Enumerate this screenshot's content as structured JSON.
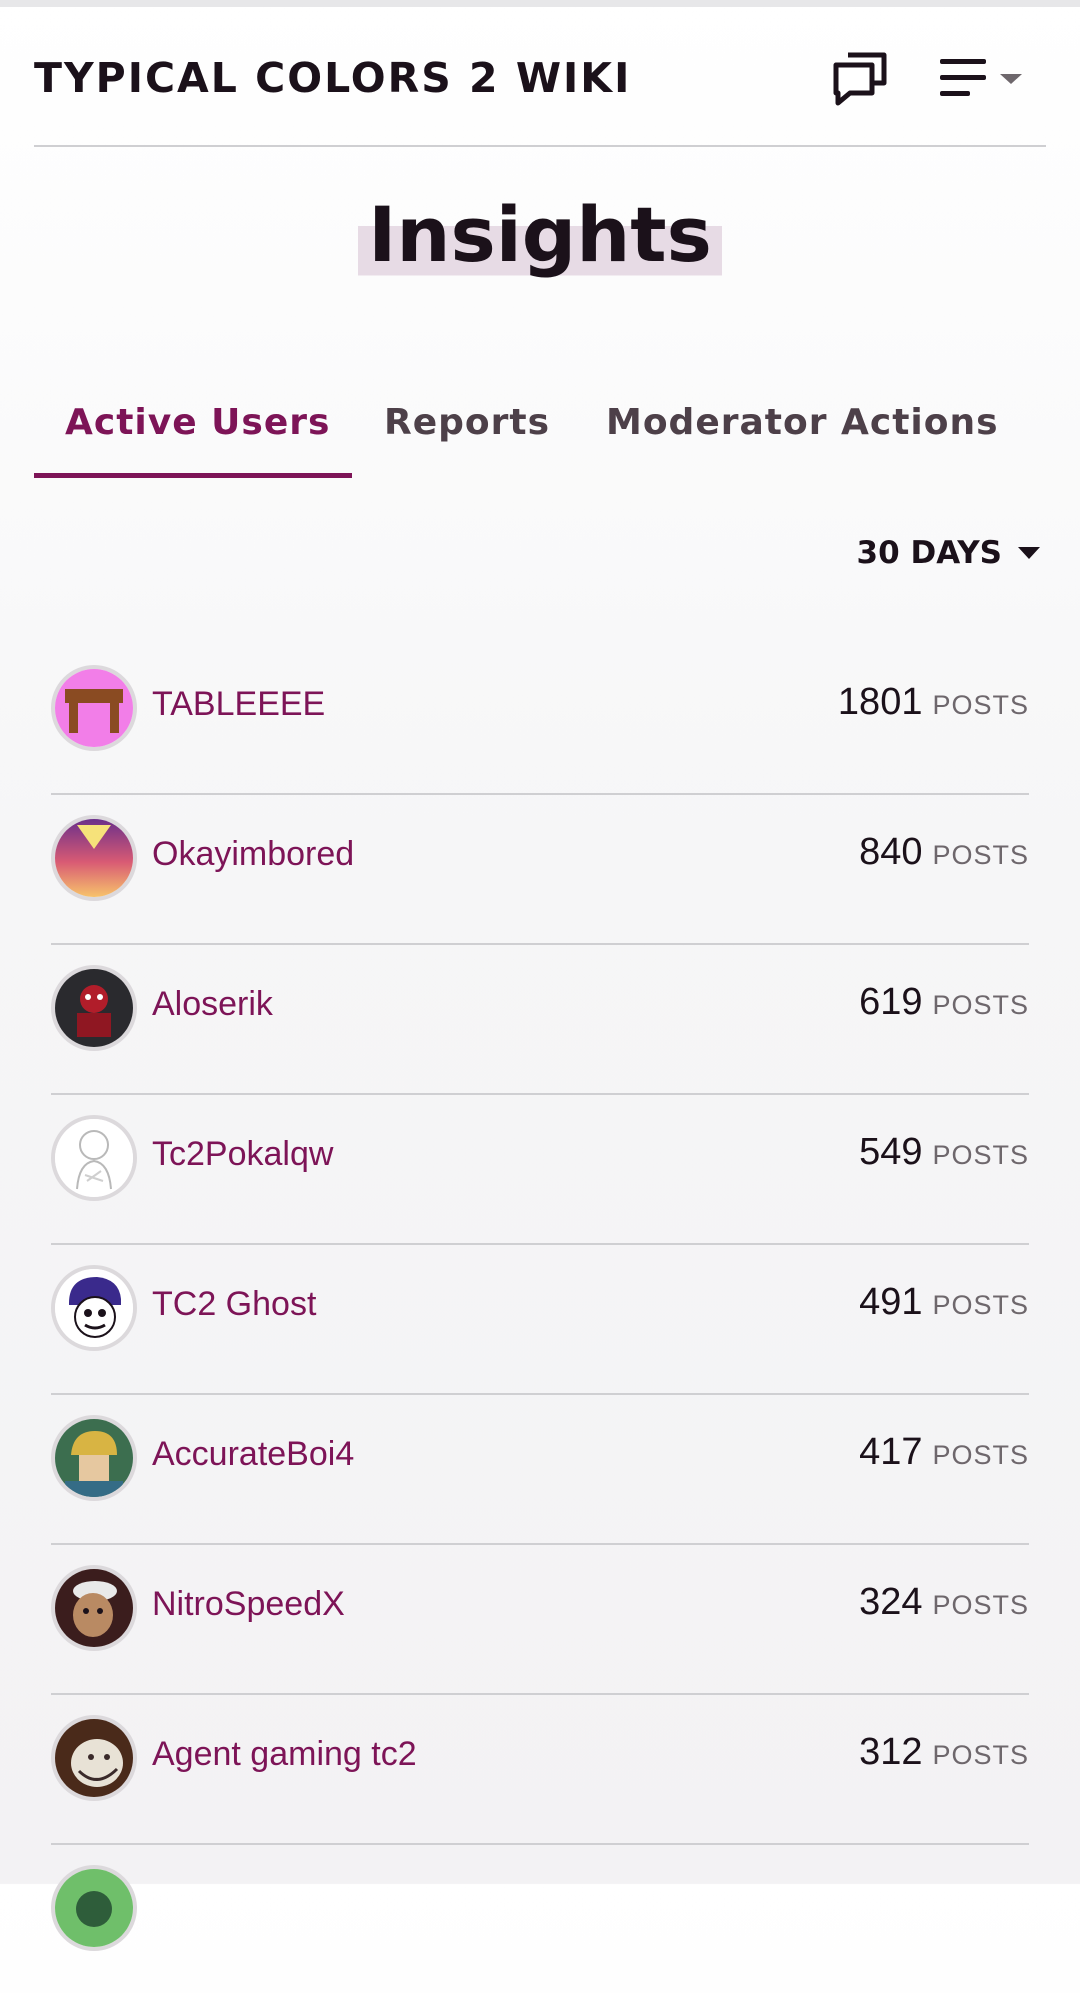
{
  "header": {
    "wiki_title": "TYPICAL COLORS 2 WIKI",
    "discussions_icon": "speech-bubbles-icon",
    "menu_icon": "hamburger-menu-icon"
  },
  "page": {
    "title": "Insights"
  },
  "tabs": [
    {
      "label": "Active Users",
      "active": true
    },
    {
      "label": "Reports",
      "active": false
    },
    {
      "label": "Moderator Actions",
      "active": false
    }
  ],
  "range": {
    "label": "30 DAYS"
  },
  "users": [
    {
      "name": "TABLEEEE",
      "count": "1801",
      "unit": "POSTS",
      "avatar": "table-avatar"
    },
    {
      "name": "Okayimbored",
      "count": "840",
      "unit": "POSTS",
      "avatar": "sunset-avatar"
    },
    {
      "name": "Aloserik",
      "count": "619",
      "unit": "POSTS",
      "avatar": "dark-figure-avatar"
    },
    {
      "name": "Tc2Pokalqw",
      "count": "549",
      "unit": "POSTS",
      "avatar": "sketch-avatar"
    },
    {
      "name": "TC2 Ghost",
      "count": "491",
      "unit": "POSTS",
      "avatar": "ghost-avatar"
    },
    {
      "name": "AccurateBoi4",
      "count": "417",
      "unit": "POSTS",
      "avatar": "helmet-avatar"
    },
    {
      "name": "NitroSpeedX",
      "count": "324",
      "unit": "POSTS",
      "avatar": "face-avatar"
    },
    {
      "name": "Agent gaming tc2",
      "count": "312",
      "unit": "POSTS",
      "avatar": "troll-avatar"
    }
  ],
  "colors": {
    "accent": "#7d1457",
    "text": "#1b111a",
    "muted": "#6e676c",
    "divider": "#cfcfd2"
  }
}
